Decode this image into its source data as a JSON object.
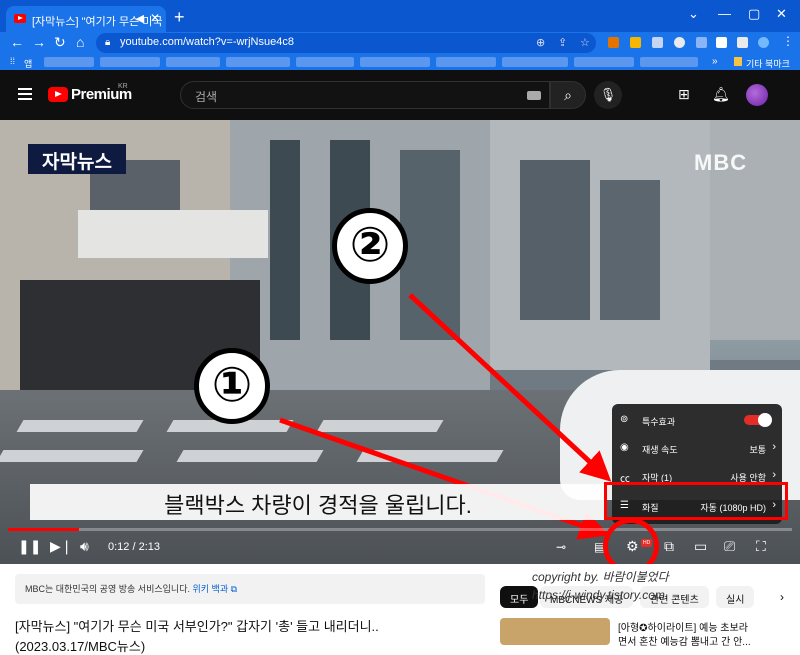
{
  "browser": {
    "tab_title": "[자막뉴스] \"여기가 무슨 미국",
    "new_tab_symbol": "+",
    "url": "youtube.com/watch?v=-wrjNsue4c8",
    "bookmarks_apps_label": "앱",
    "bookmarks_more": "»",
    "bookmarks_other": "기타 북마크",
    "window_buttons": [
      "⌄",
      "—",
      "▢",
      "✕"
    ]
  },
  "youtube": {
    "logo_text": "Premium",
    "logo_region": "KR",
    "search_placeholder": "검색"
  },
  "video": {
    "channel_badge": "자막뉴스",
    "broadcaster_logo": "MBC",
    "annotation_1": "①",
    "annotation_2": "②",
    "subtitle": "블랙박스 차량이 경적을 울립니다.",
    "current_time": "0:12",
    "duration": "2:13",
    "time_display": "0:12 / 2:13",
    "progress_fraction": 0.09,
    "hd_badge": "HD"
  },
  "settings_menu": {
    "items": [
      {
        "icon": "ambient-mode-icon",
        "label": "특수효과",
        "value": "",
        "toggle": true
      },
      {
        "icon": "playback-speed-icon",
        "label": "재생 속도",
        "value": "보통"
      },
      {
        "icon": "captions-icon",
        "label": "자막 (1)",
        "value": "사용 안함"
      },
      {
        "icon": "quality-icon",
        "label": "화질",
        "value": "자동 (1080p HD)"
      }
    ]
  },
  "below": {
    "info_text": "MBC는 대한민국의 공영 방송 서비스입니다.",
    "info_link": "위키 백과",
    "video_title": "[자막뉴스] \"여기가 무슨 미국 서부인가?\" 갑자기 '총' 들고 내리더니..",
    "video_date": "(2023.03.17/MBC뉴스)",
    "chips": [
      "모두",
      "MBCNEWS 제공",
      "관련 콘텐츠",
      "실시"
    ],
    "related_line1": "[아형✪하이라이트] 예능 초보라",
    "related_line2": "면서 혼찬 예능감 뽐내고 간 안...",
    "watermark_line1": "copyright by. 바람이불었다",
    "watermark_line2": "https://j-windy.tistory.com"
  },
  "colors": {
    "chrome_blue": "#1a73e8",
    "youtube_red": "#ff0000",
    "annotation_red": "#ff0000"
  }
}
